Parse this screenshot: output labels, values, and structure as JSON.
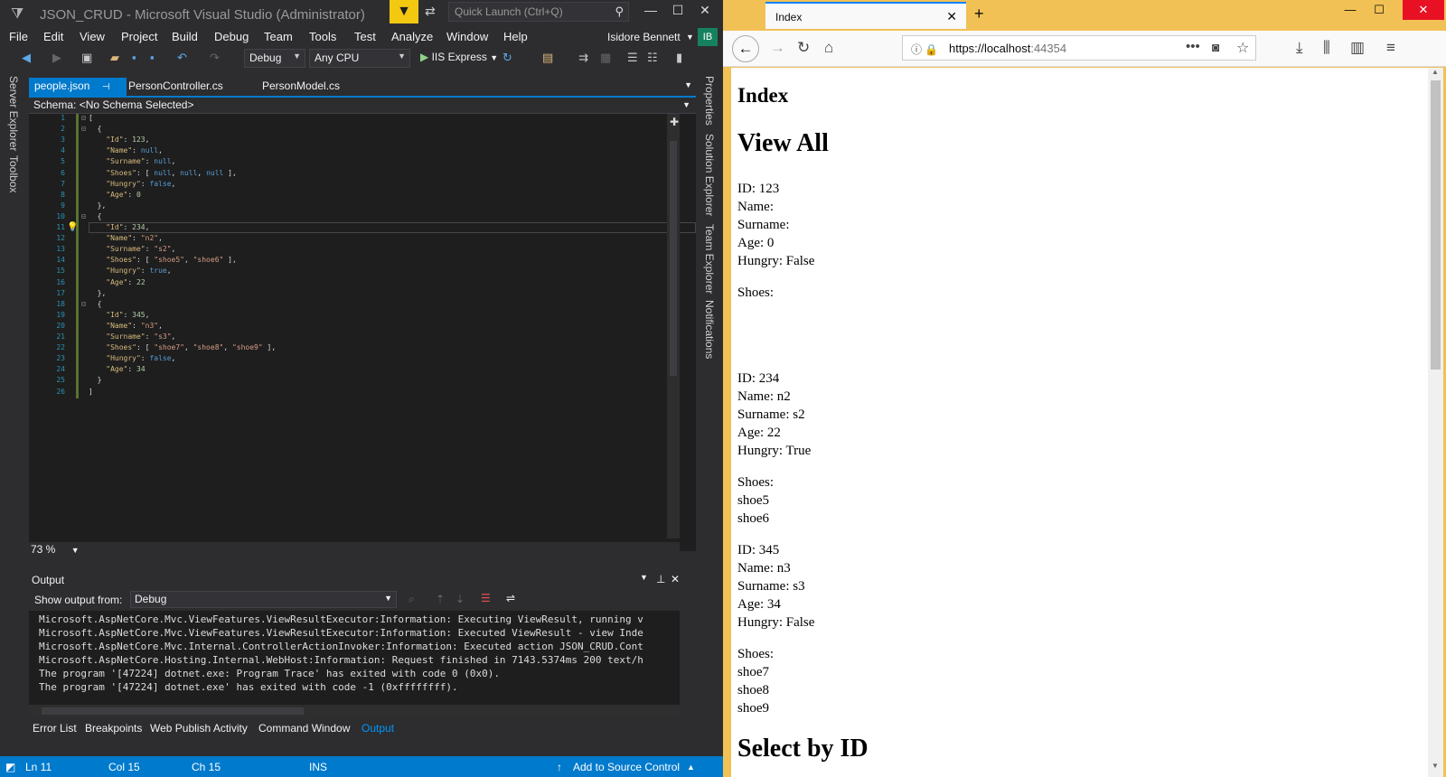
{
  "vs": {
    "title": "JSON_CRUD - Microsoft Visual Studio  (Administrator)",
    "quick_launch_placeholder": "Quick Launch (Ctrl+Q)",
    "menu": [
      "File",
      "Edit",
      "View",
      "Project",
      "Build",
      "Debug",
      "Team",
      "Tools",
      "Test",
      "Analyze",
      "Window",
      "Help"
    ],
    "user": "Isidore Bennett",
    "user_initials": "IB",
    "toolbar": {
      "config": "Debug",
      "platform": "Any CPU",
      "run": "IIS Express"
    },
    "left_tabs": [
      "Server Explorer",
      "Toolbox"
    ],
    "right_tabs": [
      "Properties",
      "Solution Explorer",
      "Team Explorer",
      "Notifications"
    ],
    "doc_tabs": [
      "people.json",
      "PersonController.cs",
      "PersonModel.cs"
    ],
    "schema_label": "Schema:",
    "schema_value": "<No Schema Selected>",
    "zoom": "73 %",
    "output_title": "Output",
    "show_output_label": "Show output from:",
    "show_output_value": "Debug",
    "output_lines": [
      "Microsoft.AspNetCore.Mvc.ViewFeatures.ViewResultExecutor:Information: Executing ViewResult, running v",
      "Microsoft.AspNetCore.Mvc.ViewFeatures.ViewResultExecutor:Information: Executed ViewResult - view Inde",
      "Microsoft.AspNetCore.Mvc.Internal.ControllerActionInvoker:Information: Executed action JSON_CRUD.Cont",
      "Microsoft.AspNetCore.Hosting.Internal.WebHost:Information: Request finished in 7143.5374ms 200 text/h",
      "The program '[47224] dotnet.exe: Program Trace' has exited with code 0 (0x0).",
      "The program '[47224] dotnet.exe' has exited with code -1 (0xffffffff)."
    ],
    "bottom_tabs": [
      "Error List",
      "Breakpoints",
      "Web Publish Activity",
      "Command Window",
      "Output"
    ],
    "status": {
      "ln": "Ln 11",
      "col": "Col 15",
      "ch": "Ch 15",
      "ins": "INS",
      "source_control": "Add to Source Control"
    }
  },
  "code_lines": [
    [
      [
        "p",
        "["
      ]
    ],
    [
      [
        "p",
        "  {"
      ]
    ],
    [
      [
        "k",
        "    \"Id\""
      ],
      [
        "p",
        ": "
      ],
      [
        "n",
        "123"
      ],
      [
        "p",
        ","
      ]
    ],
    [
      [
        "k",
        "    \"Name\""
      ],
      [
        "p",
        ": "
      ],
      [
        "b",
        "null"
      ],
      [
        "p",
        ","
      ]
    ],
    [
      [
        "k",
        "    \"Surname\""
      ],
      [
        "p",
        ": "
      ],
      [
        "b",
        "null"
      ],
      [
        "p",
        ","
      ]
    ],
    [
      [
        "k",
        "    \"Shoes\""
      ],
      [
        "p",
        ": [ "
      ],
      [
        "b",
        "null"
      ],
      [
        "p",
        ", "
      ],
      [
        "b",
        "null"
      ],
      [
        "p",
        ", "
      ],
      [
        "b",
        "null"
      ],
      [
        "p",
        " ],"
      ]
    ],
    [
      [
        "k",
        "    \"Hungry\""
      ],
      [
        "p",
        ": "
      ],
      [
        "b",
        "false"
      ],
      [
        "p",
        ","
      ]
    ],
    [
      [
        "k",
        "    \"Age\""
      ],
      [
        "p",
        ": "
      ],
      [
        "n",
        "0"
      ]
    ],
    [
      [
        "p",
        "  },"
      ]
    ],
    [
      [
        "p",
        "  {"
      ]
    ],
    [
      [
        "k",
        "    \"Id\""
      ],
      [
        "p",
        ": "
      ],
      [
        "n",
        "234"
      ],
      [
        "p",
        ","
      ]
    ],
    [
      [
        "k",
        "    \"Name\""
      ],
      [
        "p",
        ": "
      ],
      [
        "s",
        "\"n2\""
      ],
      [
        "p",
        ","
      ]
    ],
    [
      [
        "k",
        "    \"Surname\""
      ],
      [
        "p",
        ": "
      ],
      [
        "s",
        "\"s2\""
      ],
      [
        "p",
        ","
      ]
    ],
    [
      [
        "k",
        "    \"Shoes\""
      ],
      [
        "p",
        ": [ "
      ],
      [
        "s",
        "\"shoe5\""
      ],
      [
        "p",
        ", "
      ],
      [
        "s",
        "\"shoe6\""
      ],
      [
        "p",
        " ],"
      ]
    ],
    [
      [
        "k",
        "    \"Hungry\""
      ],
      [
        "p",
        ": "
      ],
      [
        "b",
        "true"
      ],
      [
        "p",
        ","
      ]
    ],
    [
      [
        "k",
        "    \"Age\""
      ],
      [
        "p",
        ": "
      ],
      [
        "n",
        "22"
      ]
    ],
    [
      [
        "p",
        "  },"
      ]
    ],
    [
      [
        "p",
        "  {"
      ]
    ],
    [
      [
        "k",
        "    \"Id\""
      ],
      [
        "p",
        ": "
      ],
      [
        "n",
        "345"
      ],
      [
        "p",
        ","
      ]
    ],
    [
      [
        "k",
        "    \"Name\""
      ],
      [
        "p",
        ": "
      ],
      [
        "s",
        "\"n3\""
      ],
      [
        "p",
        ","
      ]
    ],
    [
      [
        "k",
        "    \"Surname\""
      ],
      [
        "p",
        ": "
      ],
      [
        "s",
        "\"s3\""
      ],
      [
        "p",
        ","
      ]
    ],
    [
      [
        "k",
        "    \"Shoes\""
      ],
      [
        "p",
        ": [ "
      ],
      [
        "s",
        "\"shoe7\""
      ],
      [
        "p",
        ", "
      ],
      [
        "s",
        "\"shoe8\""
      ],
      [
        "p",
        ", "
      ],
      [
        "s",
        "\"shoe9\""
      ],
      [
        "p",
        " ],"
      ]
    ],
    [
      [
        "k",
        "    \"Hungry\""
      ],
      [
        "p",
        ": "
      ],
      [
        "b",
        "false"
      ],
      [
        "p",
        ","
      ]
    ],
    [
      [
        "k",
        "    \"Age\""
      ],
      [
        "p",
        ": "
      ],
      [
        "n",
        "34"
      ]
    ],
    [
      [
        "p",
        "  }"
      ]
    ],
    [
      [
        "p",
        "]"
      ]
    ]
  ],
  "ff": {
    "tab_title": "Index",
    "url_host": "https://localhost",
    "url_port": ":44354",
    "page": {
      "heading": "Index",
      "view_all": "View All",
      "select_by_id": "Select by ID",
      "shoes_label": "Shoes:",
      "people": [
        {
          "lines": [
            "ID: 123",
            "Name:",
            "Surname:",
            "Age: 0",
            "Hungry: False"
          ],
          "shoes": [
            "",
            "",
            ""
          ]
        },
        {
          "lines": [
            "ID: 234",
            "Name: n2",
            "Surname: s2",
            "Age: 22",
            "Hungry: True"
          ],
          "shoes": [
            "shoe5",
            "shoe6"
          ]
        },
        {
          "lines": [
            "ID: 345",
            "Name: n3",
            "Surname: s3",
            "Age: 34",
            "Hungry: False"
          ],
          "shoes": [
            "shoe7",
            "shoe8",
            "shoe9"
          ]
        }
      ]
    }
  },
  "colors": {
    "vs_accent": "#007acc",
    "ff_frame": "#f1c156",
    "filter_badge": "#f2c811"
  }
}
